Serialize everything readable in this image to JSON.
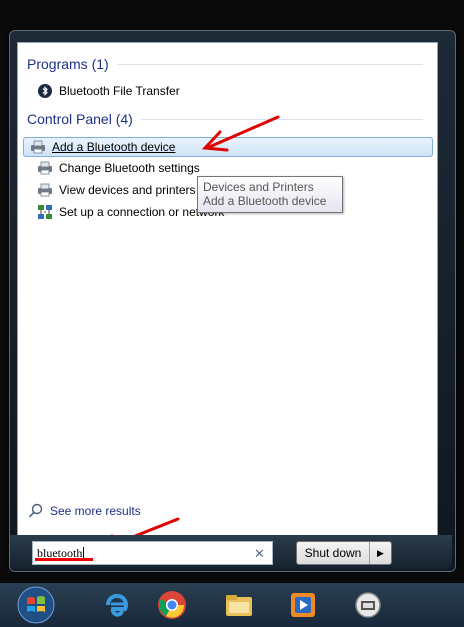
{
  "programs": {
    "header": "Programs (1)",
    "items": [
      {
        "label": "Bluetooth File Transfer",
        "icon": "bluetooth-icon"
      }
    ]
  },
  "control_panel": {
    "header": "Control Panel (4)",
    "items": [
      {
        "label": "Add a Bluetooth device",
        "icon": "devices-printers-icon"
      },
      {
        "label": "Change Bluetooth settings",
        "icon": "devices-printers-icon"
      },
      {
        "label": "View devices and printers",
        "icon": "devices-printers-icon"
      },
      {
        "label": "Set up a connection or network",
        "icon": "network-icon"
      }
    ]
  },
  "tooltip": {
    "line1": "Devices and Printers",
    "line2": "Add a Bluetooth device"
  },
  "see_more": "See more results",
  "search": {
    "value": "bluetooth"
  },
  "shutdown": {
    "label": "Shut down"
  },
  "colors": {
    "accent": "#1e3287",
    "annotation": "#e00000",
    "selection": "#cfe4f8"
  }
}
